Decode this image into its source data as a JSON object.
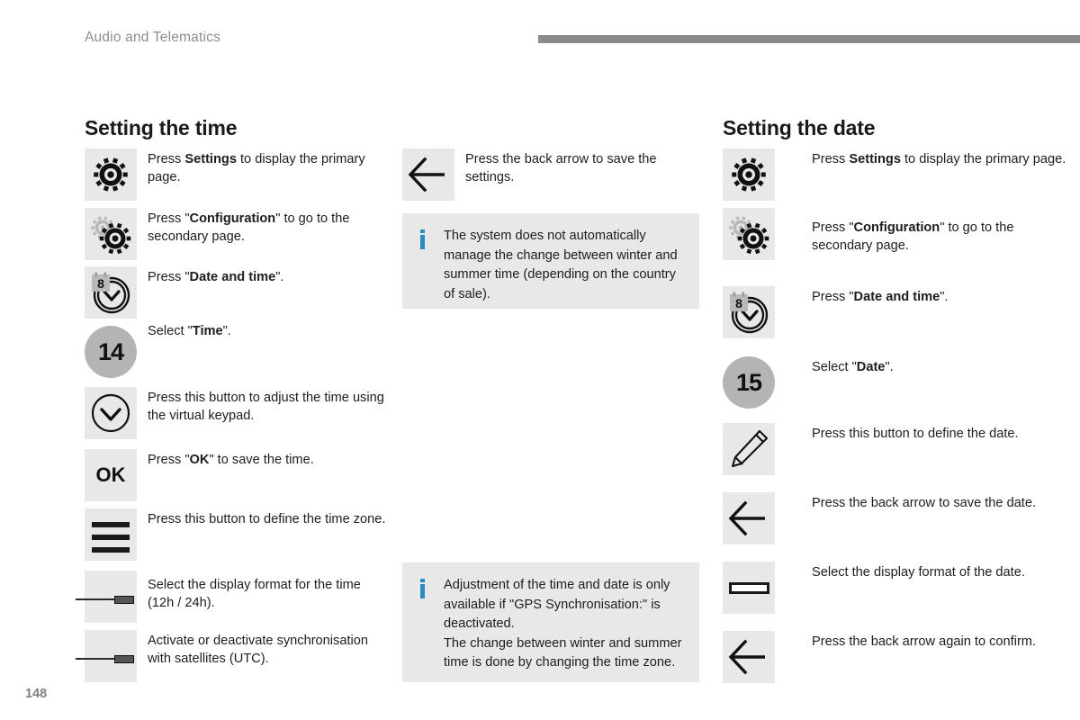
{
  "header": {
    "chapter": "Audio and Telematics"
  },
  "page_number": "148",
  "colors": {
    "info_accent": "#2b8cc4",
    "icon_box_bg": "#e8e8e8",
    "header_bar": "#8a8a8a",
    "num_circle": "#b4b4b4"
  },
  "sections": {
    "time": {
      "title": "Setting the time",
      "steps": [
        {
          "icon": "gear-icon",
          "icon_label": "",
          "text_html": "Press <b>Settings</b> to display the primary page."
        },
        {
          "icon": "double-gear-icon",
          "icon_label": "",
          "text_html": "Press \"<b>Configuration</b>\" to go to the secondary page."
        },
        {
          "icon": "clock-calendar-icon",
          "icon_label": "8",
          "text_html": "Press \"<b>Date and time</b>\"."
        },
        {
          "icon": "number-circle-icon",
          "icon_label": "14",
          "text_html": "Select \"<b>Time</b>\"."
        },
        {
          "icon": "clock-chevron-icon",
          "icon_label": "",
          "text_html": "Press this button to adjust the time using the virtual keypad."
        },
        {
          "icon": "ok-button-icon",
          "icon_label": "OK",
          "text_html": "Press \"<b>OK</b>\" to save the time."
        },
        {
          "icon": "hamburger-menu-icon",
          "icon_label": "",
          "text_html": "Press this button to define the time zone."
        },
        {
          "icon": "slider-toggle-icon",
          "icon_label": "",
          "text_html": "Select the display format for the time (12h / 24h)."
        },
        {
          "icon": "slider-toggle-icon",
          "icon_label": "",
          "text_html": "Activate or deactivate synchronisation with satellites (UTC)."
        }
      ]
    },
    "middle": {
      "steps": [
        {
          "icon": "back-arrow-icon",
          "icon_label": "",
          "text_html": "Press the back arrow to save the settings."
        }
      ],
      "notes": [
        {
          "icon": "info-icon",
          "text": "The system does not automatically manage the change between winter and summer time (depending on the country of sale)."
        },
        {
          "icon": "info-icon",
          "text": "Adjustment of the time and date is only available if \"GPS Synchronisation:\" is deactivated.\nThe change between winter and summer time is done by changing the time zone."
        }
      ]
    },
    "date": {
      "title": "Setting the date",
      "steps": [
        {
          "icon": "gear-icon",
          "icon_label": "",
          "text_html": "Press <b>Settings</b> to display the primary page."
        },
        {
          "icon": "double-gear-icon",
          "icon_label": "",
          "text_html": "Press \"<b>Configuration</b>\" to go to the secondary page."
        },
        {
          "icon": "clock-calendar-icon",
          "icon_label": "8",
          "text_html": "Press \"<b>Date and time</b>\"."
        },
        {
          "icon": "number-circle-icon",
          "icon_label": "15",
          "text_html": "Select \"<b>Date</b>\"."
        },
        {
          "icon": "pencil-icon",
          "icon_label": "",
          "text_html": "Press this button to define the date."
        },
        {
          "icon": "back-arrow-icon",
          "icon_label": "",
          "text_html": "Press the back arrow to save the date."
        },
        {
          "icon": "date-format-icon",
          "icon_label": "",
          "text_html": "Select the display format of the date."
        },
        {
          "icon": "back-arrow-icon",
          "icon_label": "",
          "text_html": "Press the back arrow again to confirm."
        }
      ]
    }
  }
}
